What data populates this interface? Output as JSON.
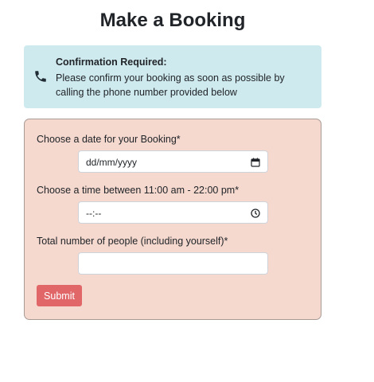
{
  "page": {
    "title": "Make a Booking"
  },
  "alert": {
    "icon": "phone-icon",
    "heading": "Confirmation Required:",
    "body": "Please confirm your booking as soon as possible by calling the phone number provided below",
    "background": "#cfeaee"
  },
  "form": {
    "background": "#f5d8ce",
    "date": {
      "label": "Choose a date for your Booking*",
      "placeholder": "dd/mm/yyyy",
      "icon": "calendar-icon"
    },
    "time": {
      "label": "Choose a time between 11:00 am - 22:00 pm*",
      "placeholder": "--:--",
      "icon": "clock-icon"
    },
    "people": {
      "label": "Total number of people (including yourself)*",
      "value": ""
    },
    "submit_label": "Submit",
    "submit_color": "#e06668"
  }
}
